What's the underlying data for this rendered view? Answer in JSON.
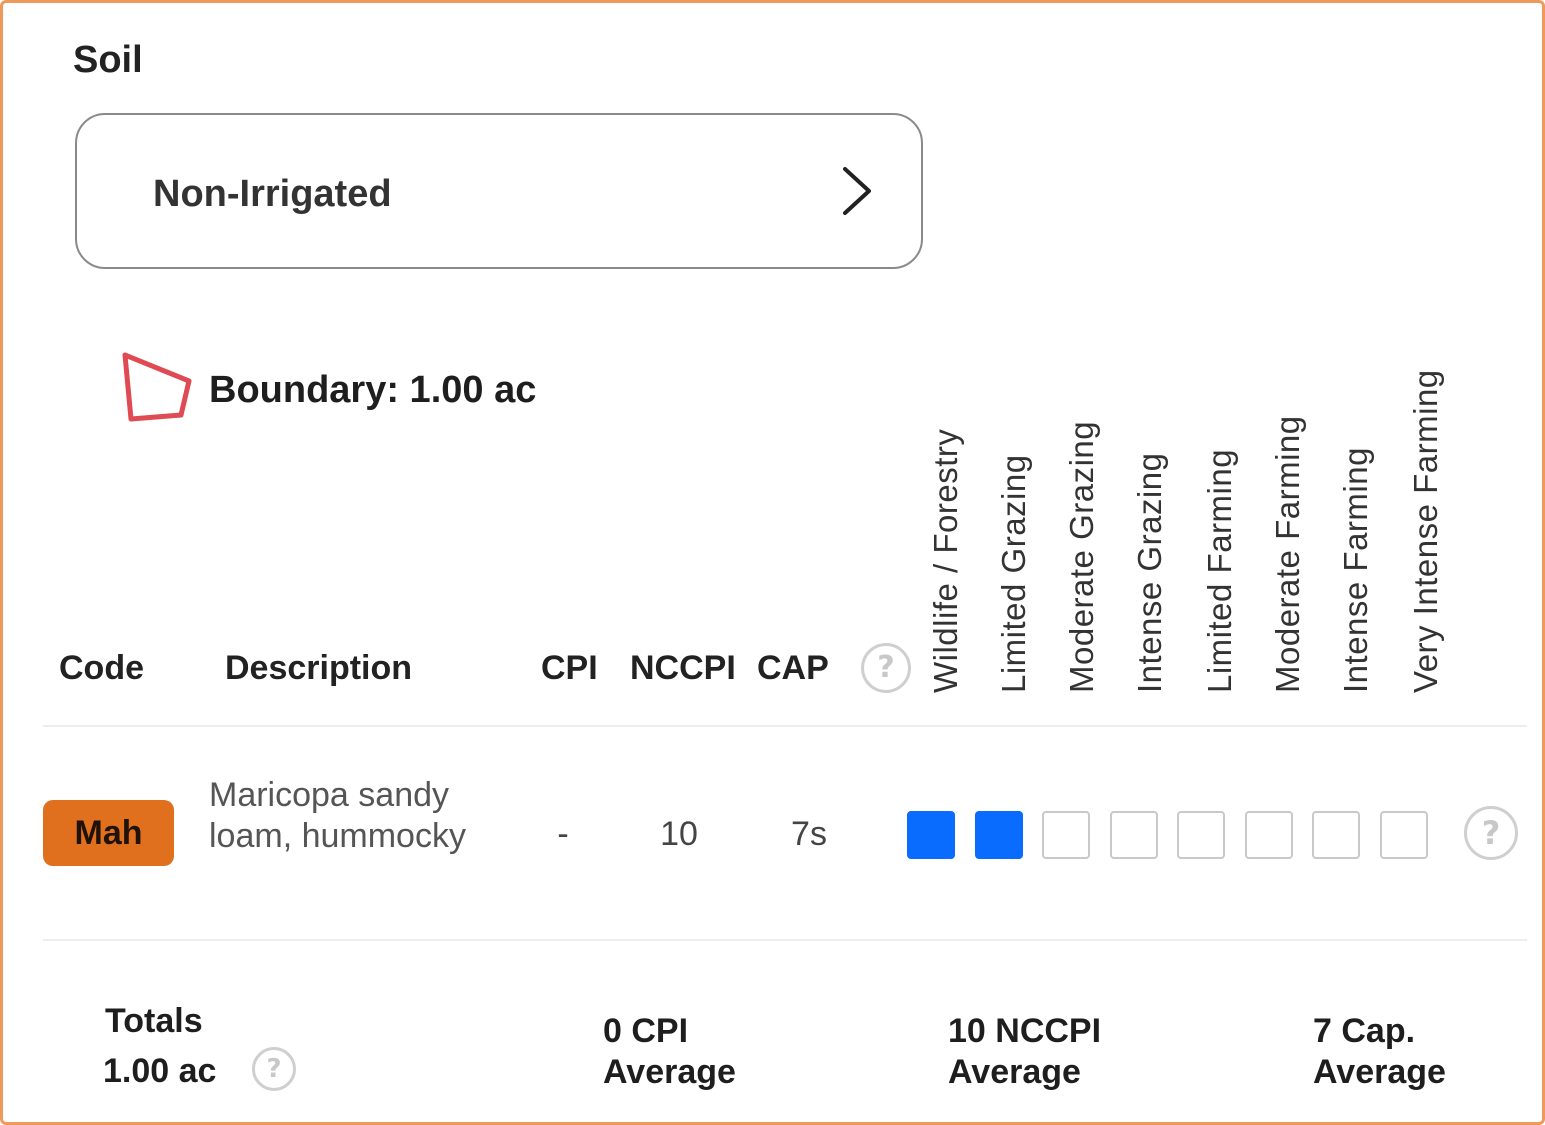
{
  "panel": {
    "title": "Soil",
    "selector_value": "Non-Irrigated"
  },
  "boundary": {
    "text": "Boundary: 1.00 ac",
    "icon": "polygon-icon",
    "color": "#e04a52"
  },
  "table": {
    "headers": {
      "code": "Code",
      "description": "Description",
      "cpi": "CPI",
      "nccpi": "NCCPI",
      "cap": "CAP"
    },
    "capability_columns": [
      "Wildlife / Forestry",
      "Limited Grazing",
      "Moderate Grazing",
      "Intense Grazing",
      "Limited Farming",
      "Moderate Farming",
      "Intense Farming",
      "Very Intense Farming"
    ],
    "rows": [
      {
        "code": "Mah",
        "code_color": "#e06f1e",
        "description": "Maricopa sandy loam, hummocky",
        "cpi": "-",
        "nccpi": "10",
        "cap": "7s",
        "capability_filled": [
          true,
          true,
          false,
          false,
          false,
          false,
          false,
          false
        ]
      }
    ]
  },
  "totals": {
    "label": "Totals",
    "area": "1.00 ac",
    "cpi_value": "0 CPI",
    "cpi_label": "Average",
    "nccpi_value": "10 NCCPI",
    "nccpi_label": "Average",
    "cap_value": "7 Cap.",
    "cap_label": "Average"
  },
  "colors": {
    "frame": "#ef9a5a",
    "filled_box": "#0a6cff",
    "empty_box_border": "#c9c9c9"
  },
  "icons": {
    "selector": "chevron-right-icon",
    "help": "help-circle-icon"
  }
}
